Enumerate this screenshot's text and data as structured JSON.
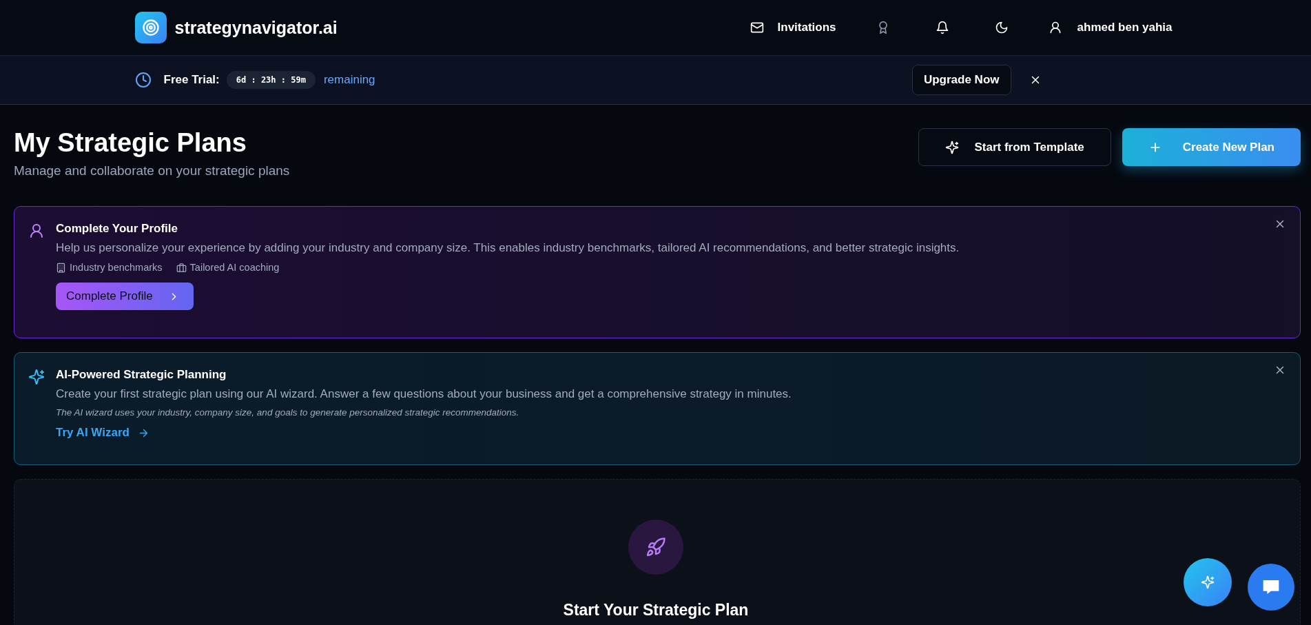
{
  "header": {
    "brand": "strategynavigator.ai",
    "invitations_label": "Invitations",
    "user_name": "ahmed ben yahia"
  },
  "trial_bar": {
    "label": "Free Trial:",
    "countdown": "6d : 23h : 59m",
    "suffix": "remaining",
    "upgrade_button": "Upgrade Now"
  },
  "page": {
    "title": "My Strategic Plans",
    "subtitle": "Manage and collaborate on your strategic plans",
    "template_button": "Start from Template",
    "create_button": "Create New Plan"
  },
  "profile_card": {
    "title": "Complete Your Profile",
    "text": "Help us personalize your experience by adding your industry and company size. This enables industry benchmarks, tailored AI recommendations, and better strategic insights.",
    "features": [
      "Industry benchmarks",
      "Tailored AI coaching"
    ],
    "button": "Complete Profile"
  },
  "ai_card": {
    "title": "AI-Powered Strategic Planning",
    "text": "Create your first strategic plan using our AI wizard. Answer a few questions about your business and get a comprehensive strategy in minutes.",
    "note": "The AI wizard uses your industry, company size, and goals to generate personalized strategic recommendations.",
    "link": "Try AI Wizard"
  },
  "empty_state": {
    "title": "Start Your Strategic Plan"
  }
}
